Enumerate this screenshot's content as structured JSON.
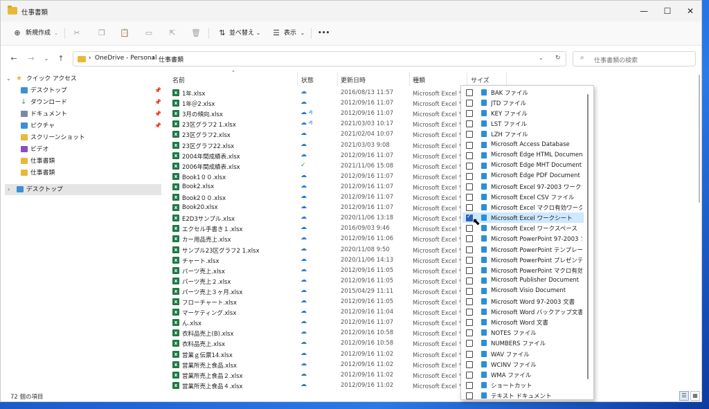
{
  "window": {
    "title": "仕事書類"
  },
  "toolbar": {
    "new_label": "新規作成",
    "sort_label": "並べ替え",
    "view_label": "表示",
    "more": "•••"
  },
  "address": {
    "root": "OneDrive - Personal",
    "folder": "仕事書類",
    "sep": "›"
  },
  "search": {
    "placeholder": "仕事書類の検索"
  },
  "nav": {
    "items": [
      {
        "label": "クイック アクセス",
        "icon": "star-icon",
        "color": "#e8b83a"
      },
      {
        "label": "デスクトップ",
        "icon": "desktop-icon",
        "color": "#3d8fd8"
      },
      {
        "label": "ダウンロード",
        "icon": "download-icon",
        "color": "#2a9a6a"
      },
      {
        "label": "ドキュメント",
        "icon": "document-icon",
        "color": "#7a8aa0"
      },
      {
        "label": "ピクチャ",
        "icon": "pictures-icon",
        "color": "#3d8fd8"
      },
      {
        "label": "スクリーンショット",
        "icon": "folder-icon",
        "color": "#e8b83a"
      },
      {
        "label": "ビデオ",
        "icon": "video-icon",
        "color": "#8a4cc8"
      },
      {
        "label": "仕事書類",
        "icon": "folder-icon",
        "color": "#e8b83a"
      },
      {
        "label": "仕事書類",
        "icon": "folder-icon",
        "color": "#e8b83a"
      },
      {
        "label": "デスクトップ",
        "icon": "desktop-icon",
        "color": "#3d8fd8"
      }
    ]
  },
  "columns": {
    "name": "名前",
    "status": "状態",
    "date": "更新日時",
    "type": "種類",
    "size": "サイズ"
  },
  "files": [
    {
      "name": "1年.xlsx",
      "status": "☁",
      "date": "2016/08/13 11:57",
      "type": "Microsoft Excel ワ"
    },
    {
      "name": "1年＠2.xlsx",
      "status": "☁",
      "date": "2012/09/16 11:07",
      "type": "Microsoft Excel ワ"
    },
    {
      "name": "3月の傾向.xlsx",
      "status": "☁ ዳ",
      "date": "2012/09/16 11:07",
      "type": "Microsoft Excel ワ"
    },
    {
      "name": "23区グラフ2 1.xlsx",
      "status": "☁ ዳ",
      "date": "2021/03/03 10:17",
      "type": "Microsoft Excel ワ"
    },
    {
      "name": "23区グラフ2.xlsx",
      "status": "☁",
      "date": "2021/02/04 10:07",
      "type": "Microsoft Excel ワ"
    },
    {
      "name": "23区グラフ22.xlsx",
      "status": "☁",
      "date": "2021/03/03 9:08",
      "type": "Microsoft Excel ワ"
    },
    {
      "name": "2004年間成績表.xlsx",
      "status": "☁",
      "date": "2012/09/16 11:07",
      "type": "Microsoft Excel ワ"
    },
    {
      "name": "2006年間成績表.xlsx",
      "status": "✓",
      "date": "2021/11/06 15:08",
      "type": "Microsoft Excel ワ"
    },
    {
      "name": "Book1００.xlsx",
      "status": "☁",
      "date": "2012/09/16 11:07",
      "type": "Microsoft Excel ワ"
    },
    {
      "name": "Book2.xlsx",
      "status": "☁",
      "date": "2012/09/16 11:07",
      "type": "Microsoft Excel ワ"
    },
    {
      "name": "Book2００.xlsx",
      "status": "☁",
      "date": "2012/09/16 11:07",
      "type": "Microsoft Excel ワ"
    },
    {
      "name": "Book20.xlsx",
      "status": "☁",
      "date": "2012/09/16 11:07",
      "type": "Microsoft Excel ワ"
    },
    {
      "name": "E2D3サンプル.xlsx",
      "status": "☁",
      "date": "2020/11/06 13:18",
      "type": "Microsoft Excel ワ"
    },
    {
      "name": "エクセル手書き１.xlsx",
      "status": "☁",
      "date": "2016/09/03 9:46",
      "type": "Microsoft Excel ワ"
    },
    {
      "name": "カー用品売上.xlsx",
      "status": "☁",
      "date": "2012/09/16 11:06",
      "type": "Microsoft Excel ワ"
    },
    {
      "name": "サンプル23区グラフ2 1.xlsx",
      "status": "☁",
      "date": "2020/11/08 9:50",
      "type": "Microsoft Excel ワ"
    },
    {
      "name": "チャート.xlsx",
      "status": "☁",
      "date": "2020/11/06 14:13",
      "type": "Microsoft Excel ワ"
    },
    {
      "name": "パーツ売上.xlsx",
      "status": "☁",
      "date": "2012/09/16 11:05",
      "type": "Microsoft Excel ワ"
    },
    {
      "name": "パーツ売上２.xlsx",
      "status": "☁",
      "date": "2012/09/16 11:05",
      "type": "Microsoft Excel ワ"
    },
    {
      "name": "パーツ売上３ヶ月.xlsx",
      "status": "☁",
      "date": "2015/04/29 11:11",
      "type": "Microsoft Excel ワ"
    },
    {
      "name": "フローチャート.xlsx",
      "status": "☁",
      "date": "2012/09/16 11:05",
      "type": "Microsoft Excel ワ"
    },
    {
      "name": "マーケティング.xlsx",
      "status": "☁",
      "date": "2012/09/16 11:04",
      "type": "Microsoft Excel ワ"
    },
    {
      "name": "ん.xlsx",
      "status": "☁",
      "date": "2012/09/16 11:07",
      "type": "Microsoft Excel ワ"
    },
    {
      "name": "衣料品売上(B).xlsx",
      "status": "☁",
      "date": "2012/09/16 10:58",
      "type": "Microsoft Excel ワ"
    },
    {
      "name": "衣料品売上.xlsx",
      "status": "☁",
      "date": "2012/09/16 10:58",
      "type": "Microsoft Excel ワ"
    },
    {
      "name": "営業ｇ伝票14.xlsx",
      "status": "☁",
      "date": "2012/09/16 11:02",
      "type": "Microsoft Excel ワ"
    },
    {
      "name": "営業所売上食品.xlsx",
      "status": "☁",
      "date": "2012/09/16 11:02",
      "type": "Microsoft Excel ワ"
    },
    {
      "name": "営業所売上食品２.xlsx",
      "status": "☁",
      "date": "2012/09/16 11:02",
      "type": "Microsoft Excel ワ"
    },
    {
      "name": "営業所売上食品４.xlsx",
      "status": "☁",
      "date": "2012/09/16 11:02",
      "type": "Microsoft Excel ワ"
    }
  ],
  "filter": {
    "items": [
      {
        "label": "BAK ファイル",
        "checked": false
      },
      {
        "label": "JTD ファイル",
        "checked": false
      },
      {
        "label": "KEY ファイル",
        "checked": false
      },
      {
        "label": "LST ファイル",
        "checked": false
      },
      {
        "label": "LZH ファイル",
        "checked": false
      },
      {
        "label": "Microsoft Access Database",
        "checked": false
      },
      {
        "label": "Microsoft Edge HTML Document",
        "checked": false
      },
      {
        "label": "Microsoft Edge MHT Document",
        "checked": false
      },
      {
        "label": "Microsoft Edge PDF Document",
        "checked": false
      },
      {
        "label": "Microsoft Excel 97-2003 ワークシート",
        "checked": false
      },
      {
        "label": "Microsoft Excel CSV ファイル",
        "checked": false
      },
      {
        "label": "Microsoft Excel マクロ有効ワークシ...",
        "checked": false
      },
      {
        "label": "Microsoft Excel ワークシート",
        "checked": true
      },
      {
        "label": "Microsoft Excel ワークスペース",
        "checked": false
      },
      {
        "label": "Microsoft PowerPoint 97-2003 プ...",
        "checked": false
      },
      {
        "label": "Microsoft PowerPoint テンプレート",
        "checked": false
      },
      {
        "label": "Microsoft PowerPoint プレゼンテー...",
        "checked": false
      },
      {
        "label": "Microsoft PowerPoint マクロ有効...",
        "checked": false
      },
      {
        "label": "Microsoft Publisher Document",
        "checked": false
      },
      {
        "label": "Microsoft Visio Document",
        "checked": false
      },
      {
        "label": "Microsoft Word 97-2003 文書",
        "checked": false
      },
      {
        "label": "Microsoft Word バックアップ文書",
        "checked": false
      },
      {
        "label": "Microsoft Word 文書",
        "checked": false
      },
      {
        "label": "NOTES ファイル",
        "checked": false
      },
      {
        "label": "NUMBERS ファイル",
        "checked": false
      },
      {
        "label": "WAV ファイル",
        "checked": false
      },
      {
        "label": "WCINV ファイル",
        "checked": false
      },
      {
        "label": "WMA ファイル",
        "checked": false
      },
      {
        "label": "ショートカット",
        "checked": false
      },
      {
        "label": "テキスト ドキュメント",
        "checked": false
      }
    ]
  },
  "statusbar": {
    "count": "72 個の項目"
  }
}
